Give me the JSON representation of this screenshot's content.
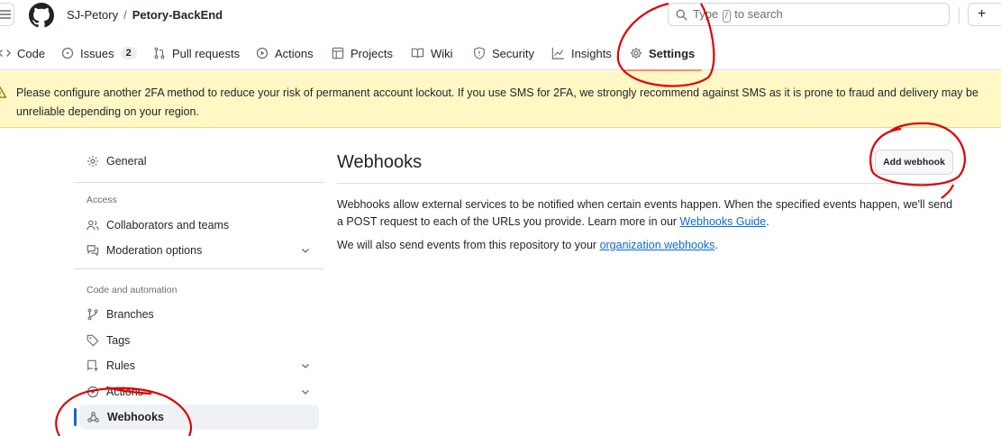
{
  "header": {
    "owner": "SJ-Petory",
    "separator": "/",
    "repo": "Petory-BackEnd",
    "search": {
      "prefix": "Type",
      "key": "/",
      "suffix": "to search"
    },
    "plus": "+"
  },
  "tabs": [
    {
      "label": "Code",
      "icon": "code-icon"
    },
    {
      "label": "Issues",
      "icon": "issue-icon",
      "counter": "2"
    },
    {
      "label": "Pull requests",
      "icon": "pull-request-icon"
    },
    {
      "label": "Actions",
      "icon": "play-icon"
    },
    {
      "label": "Projects",
      "icon": "table-icon"
    },
    {
      "label": "Wiki",
      "icon": "book-icon"
    },
    {
      "label": "Security",
      "icon": "shield-icon"
    },
    {
      "label": "Insights",
      "icon": "graph-icon"
    },
    {
      "label": "Settings",
      "icon": "gear-icon",
      "selected": true
    }
  ],
  "banner": {
    "text": "Please configure another 2FA method to reduce your risk of permanent account lockout. If you use SMS for 2FA, we strongly recommend against SMS as it is prone to fraud and delivery may be unreliable depending on your region."
  },
  "sidebar": {
    "general": "General",
    "access_heading": "Access",
    "collaborators": "Collaborators and teams",
    "moderation": "Moderation options",
    "code_heading": "Code and automation",
    "branches": "Branches",
    "tags": "Tags",
    "rules": "Rules",
    "actions": "Actions",
    "webhooks": "Webhooks"
  },
  "main": {
    "title": "Webhooks",
    "add_button": "Add webhook",
    "desc_1": "Webhooks allow external services to be notified when certain events happen. When the specified events happen, we'll send a POST request to each of the URLs you provide. Learn more in our ",
    "desc_link": "Webhooks Guide",
    "desc_end": ".",
    "desc2_1": "We will also send events from this repository to your ",
    "desc2_link": "organization webhooks",
    "desc2_end": "."
  },
  "colors": {
    "link": "#0969da",
    "banner_bg": "#fff8c5",
    "selected_underline": "#fd8c73",
    "annotation": "#e00000"
  }
}
